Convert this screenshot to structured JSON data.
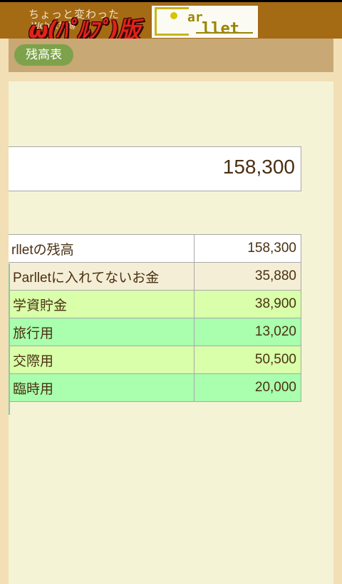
{
  "header": {
    "subtitle": "ちょっと変わった",
    "subtitle_small": "Web家計簿",
    "brand_title": "ω(ﾊﾟﾙﾌﾟ)版",
    "logo_text_ar": "ar",
    "logo_text_llet": "llet"
  },
  "toolbar": {
    "badge_label": "残高表"
  },
  "summary": {
    "total": "158,300"
  },
  "breakdown": {
    "rows": [
      {
        "label": "rlletの残高",
        "value": "158,300"
      },
      {
        "label": "Parlletに入れてないお金",
        "value": "35,880"
      },
      {
        "label": "学資貯金",
        "value": "38,900"
      },
      {
        "label": "旅行用",
        "value": "13,020"
      },
      {
        "label": "交際用",
        "value": "50,500"
      },
      {
        "label": "臨時用",
        "value": "20,000"
      }
    ]
  },
  "colors": {
    "header_bg": "#a56a14",
    "badge_bg": "#7da24b",
    "row_lime": "#d9ffaa",
    "row_mint": "#a9ffad"
  }
}
